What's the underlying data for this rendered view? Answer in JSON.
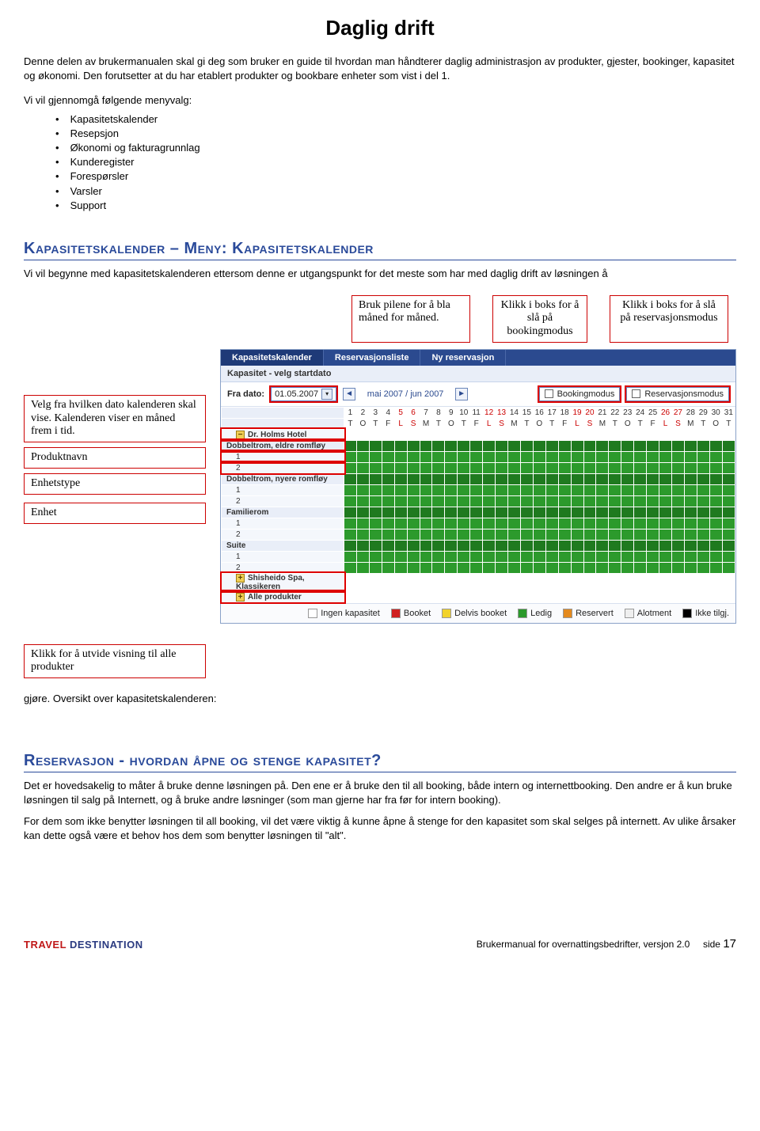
{
  "title": "Daglig drift",
  "intro": {
    "p1": "Denne delen av brukermanualen skal gi deg som bruker en guide til hvordan man håndterer daglig administrasjon av produkter, gjester, bookinger, kapasitet og økonomi. Den forutsetter at du har etablert produkter og bookbare enheter som vist i del 1.",
    "menu_intro": "Vi vil gjennomgå følgende menyvalg:",
    "bullets": [
      "Kapasitetskalender",
      "Resepsjon",
      "Økonomi og fakturagrunnlag",
      "Kunderegister",
      "Forespørsler",
      "Varsler",
      "Support"
    ]
  },
  "section1": {
    "heading": "Kapasitetskalender – Meny: Kapasitetskalender",
    "body": "Vi vil begynne med kapasitetskalenderen ettersom denne er utgangspunkt for det meste som har med daglig drift av løsningen å"
  },
  "callouts": {
    "arrows": "Bruk pilene for å bla måned for måned.",
    "booking": "Klikk i boks for å slå på bookingmodus",
    "reservation": "Klikk i boks for å slå på reservasjonsmodus",
    "from_date": "Velg fra hvilken dato kalenderen skal vise. Kalenderen viser en måned frem i tid.",
    "product_name": "Produktnavn",
    "unit_type": "Enhetstype",
    "unit": "Enhet",
    "expand": "Klikk for å utvide visning til alle produkter"
  },
  "app": {
    "tabs": [
      "Kapasitetskalender",
      "Reservasjonsliste",
      "Ny reservasjon"
    ],
    "subhead": "Kapasitet - velg startdato",
    "from_label": "Fra dato:",
    "from_value": "01.05.2007",
    "month_label": "mai 2007 / jun 2007",
    "mode_booking": "Bookingmodus",
    "mode_reservation": "Reservasjonsmodus",
    "days": [
      "1",
      "2",
      "3",
      "4",
      "5",
      "6",
      "7",
      "8",
      "9",
      "10",
      "11",
      "12",
      "13",
      "14",
      "15",
      "16",
      "17",
      "18",
      "19",
      "20",
      "21",
      "22",
      "23",
      "24",
      "25",
      "26",
      "27",
      "28",
      "29",
      "30",
      "31"
    ],
    "wdays": [
      "T",
      "O",
      "T",
      "F",
      "L",
      "S",
      "M",
      "T",
      "O",
      "T",
      "F",
      "L",
      "S",
      "M",
      "T",
      "O",
      "T",
      "F",
      "L",
      "S",
      "M",
      "T",
      "O",
      "T",
      "F",
      "L",
      "S",
      "M",
      "T",
      "O",
      "T"
    ],
    "red_idx": [
      4,
      5,
      11,
      12,
      18,
      19,
      25,
      26
    ],
    "product": "Dr. Holms Hotel",
    "groups": [
      {
        "name": "Dobbeltrom, eldre romfløy",
        "rows": [
          "1",
          "2"
        ]
      },
      {
        "name": "Dobbeltrom, nyere romfløy",
        "rows": [
          "1",
          "2"
        ]
      },
      {
        "name": "Familierom",
        "rows": [
          "1",
          "2"
        ]
      },
      {
        "name": "Suite",
        "rows": [
          "1",
          "2"
        ]
      }
    ],
    "extra_rows": [
      "Shisheido Spa, Klassikeren",
      "Alle produkter"
    ],
    "legend": [
      {
        "label": "Ingen kapasitet",
        "cls": "sw-white"
      },
      {
        "label": "Booket",
        "cls": "sw-red"
      },
      {
        "label": "Delvis booket",
        "cls": "sw-yellow"
      },
      {
        "label": "Ledig",
        "cls": "sw-green"
      },
      {
        "label": "Reservert",
        "cls": "sw-orange"
      },
      {
        "label": "Alotment",
        "cls": "sw-gray"
      },
      {
        "label": "Ikke tilgj.",
        "cls": "sw-black"
      }
    ]
  },
  "after_img": "gjøre. Oversikt over kapasitetskalenderen:",
  "section2": {
    "heading": "Reservasjon - hvordan åpne og stenge kapasitet?",
    "p1": "Det er hovedsakelig to måter å bruke denne løsningen på. Den ene er å bruke den til all booking, både intern og internettbooking. Den andre er å kun bruke løsningen til salg på Internett, og å bruke andre løsninger (som man gjerne har fra før for intern booking).",
    "p2": "For dem som ikke benytter løsningen til all booking, vil det være viktig å kunne åpne å stenge for den kapasitet som skal selges på internett. Av ulike årsaker kan dette også være et behov hos dem som benytter løsningen til \"alt\"."
  },
  "footer": {
    "brand1": "TRAVEL",
    "brand2": "DESTINATION",
    "text": "Brukermanual for overnattingsbedrifter, versjon 2.0",
    "page_label": "side",
    "page_num": "17"
  }
}
